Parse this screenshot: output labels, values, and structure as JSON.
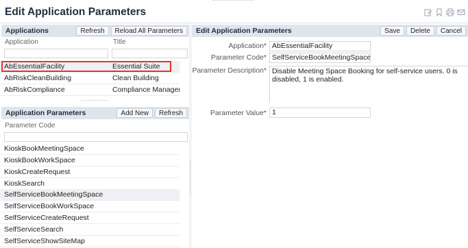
{
  "header": {
    "title": "Edit Application Parameters"
  },
  "applications": {
    "title": "Applications",
    "refresh_label": "Refresh",
    "reload_label": "Reload All Parameters",
    "col_application": "Application",
    "col_title": "Title",
    "rows": [
      {
        "application": "AbEssentialFacility",
        "title": "Essential Suite"
      },
      {
        "application": "AbRiskCleanBuilding",
        "title": "Clean Building"
      },
      {
        "application": "AbRiskCompliance",
        "title": "Compliance Managem"
      }
    ]
  },
  "app_parameters": {
    "title": "Application Parameters",
    "add_new_label": "Add New",
    "refresh_label": "Refresh",
    "col_parameter_code": "Parameter Code",
    "rows": [
      "KioskBookMeetingSpace",
      "KioskBookWorkSpace",
      "KioskCreateRequest",
      "KioskSearch",
      "SelfServiceBookMeetingSpace",
      "SelfServiceBookWorkSpace",
      "SelfServiceCreateRequest",
      "SelfServiceSearch",
      "SelfServiceShowSiteMap"
    ]
  },
  "edit_form": {
    "title": "Edit Application Parameters",
    "save_label": "Save",
    "delete_label": "Delete",
    "cancel_label": "Cancel",
    "application_label": "Application*",
    "application_value": "AbEssentialFacility",
    "parameter_code_label": "Parameter Code*",
    "parameter_code_value": "SelfServiceBookMeetingSpace",
    "parameter_description_label": "Parameter Description*",
    "parameter_description_value": "Disable Meeting Space Booking for self-service users. 0 is disabled, 1 is enabled.",
    "parameter_value_label": "Parameter Value*",
    "parameter_value_value": "1"
  },
  "colors": {
    "header_bar": "#dfe5ec",
    "selection_outline": "#e5332a",
    "selected_row": "#eef0f3"
  },
  "icons": [
    "edit-icon",
    "bookmark-icon",
    "print-icon",
    "email-icon"
  ]
}
